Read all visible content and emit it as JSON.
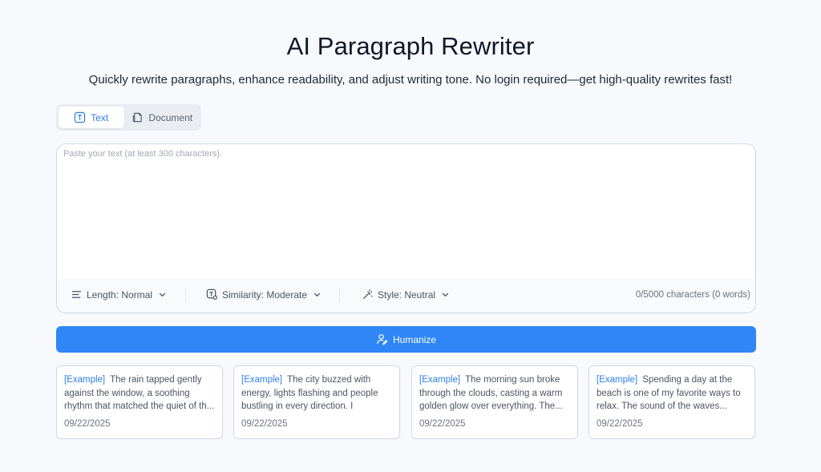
{
  "header": {
    "title": "AI Paragraph Rewriter",
    "subtitle": "Quickly rewrite paragraphs, enhance readability, and adjust writing tone. No login required—get high-quality rewrites fast!"
  },
  "mode_tabs": [
    {
      "label": "Text",
      "icon": "text-icon",
      "active": true
    },
    {
      "label": "Document",
      "icon": "document-icon",
      "active": false
    }
  ],
  "editor": {
    "placeholder": "Paste your text (at least 300 characters).",
    "value": ""
  },
  "options": {
    "length_label": "Length: Normal",
    "similarity_label": "Similarity: Moderate",
    "style_label": "Style: Neutral",
    "counter": "0/5000 characters (0 words)"
  },
  "action": {
    "humanize_label": "Humanize"
  },
  "examples": [
    {
      "tag": "[Example]",
      "text": "The rain tapped gently against the window, a soothing rhythm that matched the quiet of th...",
      "date": "09/22/2025"
    },
    {
      "tag": "[Example]",
      "text": "The city buzzed with energy, lights flashing and people bustling in every direction. I weaved...",
      "date": "09/22/2025"
    },
    {
      "tag": "[Example]",
      "text": "The morning sun broke through the clouds, casting a warm golden glow over everything. The...",
      "date": "09/22/2025"
    },
    {
      "tag": "[Example]",
      "text": "Spending a day at the beach is one of my favorite ways to relax. The sound of the waves...",
      "date": "09/22/2025"
    }
  ],
  "colors": {
    "accent": "#2f86f6",
    "background": "#f7f9fc",
    "border": "#cfd8e6"
  }
}
